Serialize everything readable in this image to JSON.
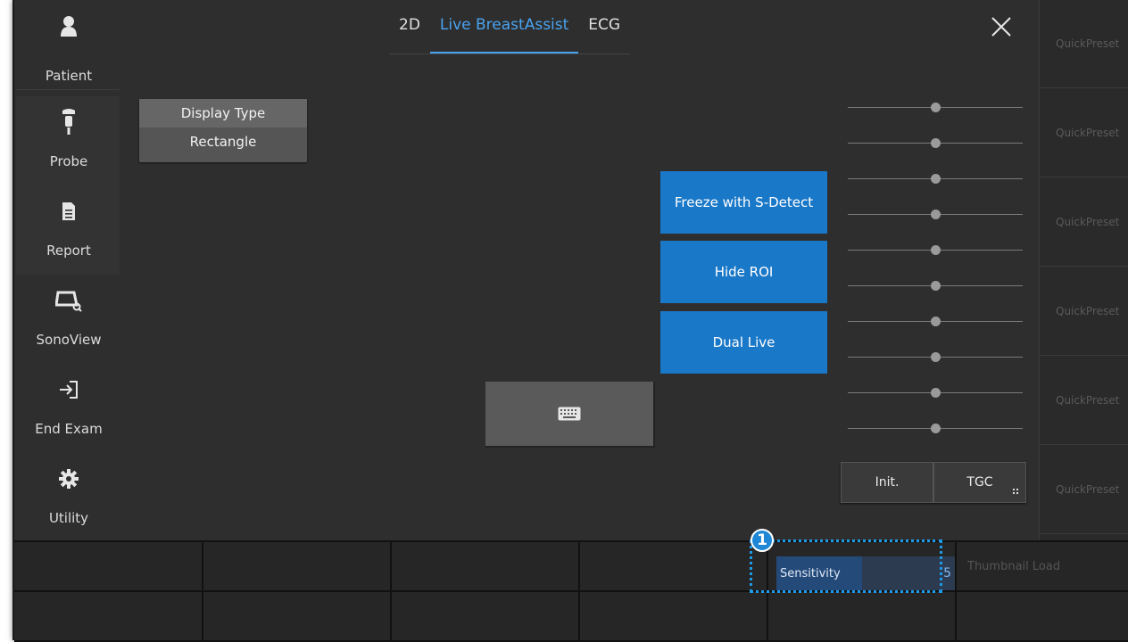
{
  "sidebar": {
    "items": [
      {
        "label": "Patient",
        "icon": "person-icon"
      },
      {
        "label": "Probe",
        "icon": "probe-icon"
      },
      {
        "label": "Report",
        "icon": "document-icon"
      },
      {
        "label": "SonoView",
        "icon": "sonoview-icon"
      },
      {
        "label": "End Exam",
        "icon": "exit-icon"
      },
      {
        "label": "Utility",
        "icon": "gear-icon"
      }
    ]
  },
  "tabs": [
    {
      "label": "2D",
      "active": false
    },
    {
      "label": "Live BreastAssist",
      "active": true
    },
    {
      "label": "ECG",
      "active": false
    }
  ],
  "display_type": {
    "title": "Display Type",
    "value": "Rectangle"
  },
  "actions": {
    "freeze_label": "Freeze with S-Detect",
    "hide_roi_label": "Hide ROI",
    "dual_live_label": "Dual Live",
    "keyboard_icon": "keyboard-icon"
  },
  "tgc": {
    "slider_levels": [
      0.5,
      0.5,
      0.5,
      0.5,
      0.5,
      0.5,
      0.5,
      0.5,
      0.5,
      0.5
    ],
    "init_label": "Init.",
    "tgc_label": "TGC"
  },
  "quick_presets": [
    "QuickPreset",
    "QuickPreset",
    "QuickPreset",
    "QuickPreset",
    "QuickPreset",
    "QuickPreset"
  ],
  "bottom": {
    "sensitivity_label": "Sensitivity",
    "sensitivity_value": "5",
    "thumbnail_load": "Thumbnail Load",
    "callout_number": "1"
  },
  "colors": {
    "accent": "#4aa3f0",
    "button_blue": "#1a78c8",
    "callout": "#1e9be8"
  }
}
